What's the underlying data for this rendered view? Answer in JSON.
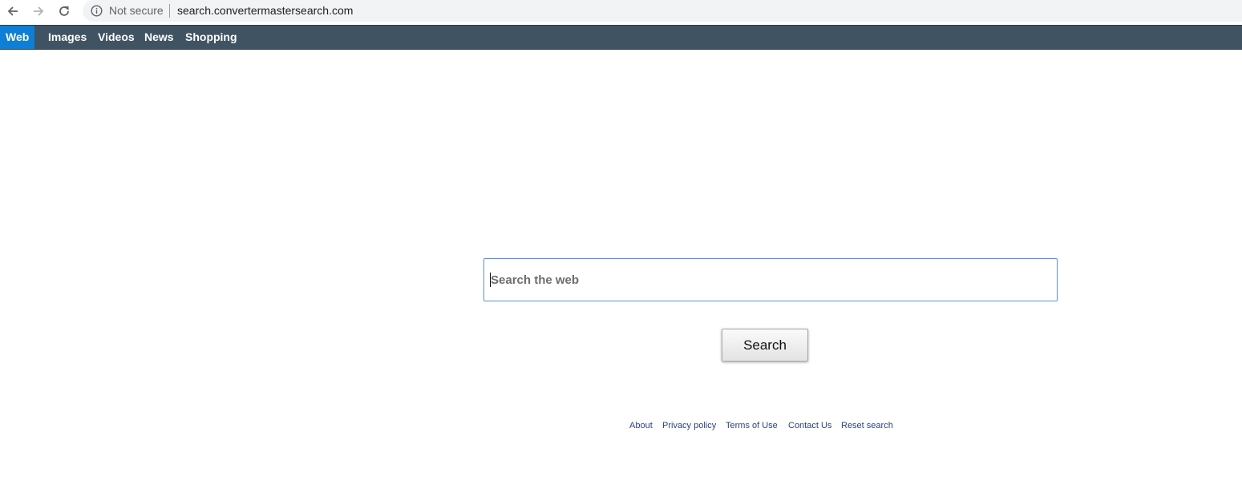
{
  "browser": {
    "security_label": "Not secure",
    "url": "search.convertermastersearch.com"
  },
  "nav": {
    "tabs": [
      {
        "label": "Web",
        "active": true
      },
      {
        "label": "Images",
        "active": false
      },
      {
        "label": "Videos",
        "active": false
      },
      {
        "label": "News",
        "active": false
      },
      {
        "label": "Shopping",
        "active": false
      }
    ]
  },
  "search": {
    "placeholder": "Search the web",
    "button_label": "Search"
  },
  "footer": {
    "links": [
      "About",
      "Privacy policy",
      "Terms of Use",
      "Contact Us",
      "Reset search"
    ]
  },
  "colors": {
    "topbar": "#3f5363",
    "active_tab": "#0e7fd6",
    "input_border": "#5b8fe0",
    "footer_link": "#2a3f8f"
  }
}
